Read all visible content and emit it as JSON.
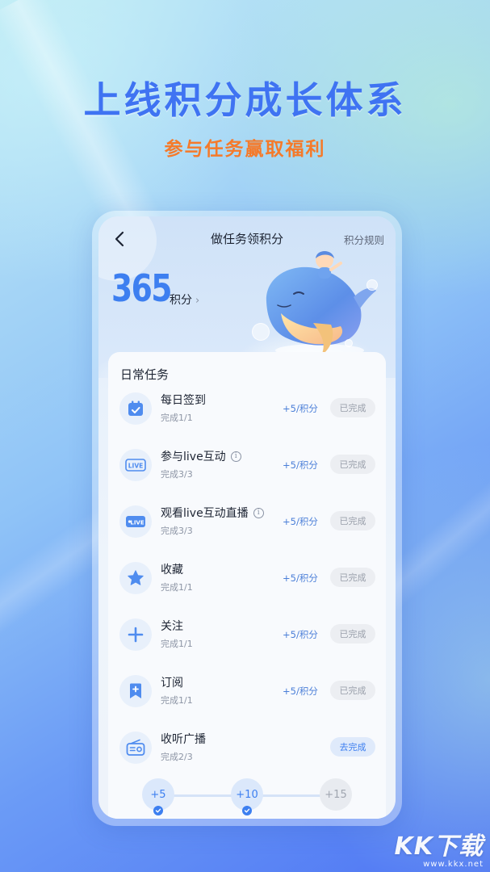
{
  "promo": {
    "headline": "上线积分成长体系",
    "subline": "参与任务赢取福利"
  },
  "nav": {
    "back_icon": "chevron-left-icon",
    "title": "做任务领积分",
    "rules_label": "积分规则"
  },
  "points": {
    "value": "365",
    "unit_label": "积分",
    "chevron": "›"
  },
  "daily_tasks": {
    "title": "日常任务",
    "items": [
      {
        "name": "每日签到",
        "icon": "calendar-check-icon",
        "has_info": false,
        "progress": "完成1/1",
        "reward": "+5/积分",
        "status": "已完成",
        "completed": true
      },
      {
        "name": "参与live互动",
        "icon": "live-badge-icon",
        "has_info": true,
        "progress": "完成3/3",
        "reward": "+5/积分",
        "status": "已完成",
        "completed": true
      },
      {
        "name": "观看live互动直播",
        "icon": "live-stream-icon",
        "has_info": true,
        "progress": "完成3/3",
        "reward": "+5/积分",
        "status": "已完成",
        "completed": true
      },
      {
        "name": "收藏",
        "icon": "star-icon",
        "has_info": false,
        "progress": "完成1/1",
        "reward": "+5/积分",
        "status": "已完成",
        "completed": true
      },
      {
        "name": "关注",
        "icon": "plus-icon",
        "has_info": false,
        "progress": "完成1/1",
        "reward": "+5/积分",
        "status": "已完成",
        "completed": true
      },
      {
        "name": "订阅",
        "icon": "bookmark-plus-icon",
        "has_info": false,
        "progress": "完成1/1",
        "reward": "+5/积分",
        "status": "已完成",
        "completed": true
      },
      {
        "name": "收听广播",
        "icon": "radio-icon",
        "has_info": false,
        "progress": "完成2/3",
        "reward": "",
        "status": "去完成",
        "completed": false
      }
    ]
  },
  "milestones": [
    {
      "label": "+5",
      "reached": true
    },
    {
      "label": "+10",
      "reached": true
    },
    {
      "label": "+15",
      "reached": false
    }
  ],
  "watermark": {
    "logo": "KK下载",
    "url": "www.kkx.net"
  },
  "colors": {
    "accent_blue": "#3d7ff0",
    "headline_blue": "#3f73f2",
    "subline_orange": "#f57a2a",
    "done_button_bg": "#eceef2"
  }
}
